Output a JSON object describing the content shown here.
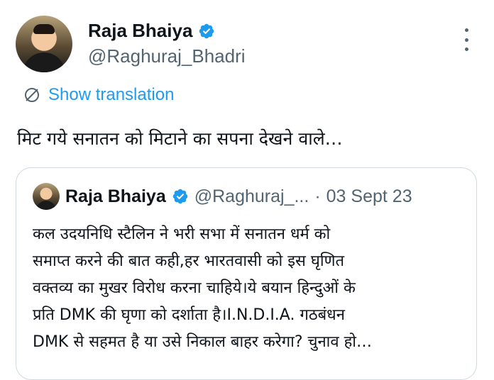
{
  "author": {
    "display_name": "Raja Bhaiya",
    "handle": "@Raghuraj_Bhadri",
    "verified_icon": "verified-badge-icon"
  },
  "translate": {
    "label": "Show translation",
    "icon": "globe-icon"
  },
  "tweet": {
    "text": "मिट गये सनातन को मिटाने का सपना देखने वाले…"
  },
  "quoted_tweet": {
    "display_name": "Raja Bhaiya",
    "handle": "@Raghuraj_...",
    "separator": "·",
    "date": "03 Sept 23",
    "lines": [
      "कल उदयनिधि स्टैलिन ने भरी सभा में सनातन धर्म को",
      "समाप्त करने की बात कही,हर भारतवासी को इस घृणित",
      "वक्तव्य का मुखर विरोध करना चाहिये।ये बयान हिन्दुओं के",
      "प्रति DMK की घृणा को दर्शाता है।I.N.D.I.A. गठबंधन",
      "DMK से सहमत है या उसे निकाल बाहर करेगा? चुनाव हो…"
    ]
  },
  "colors": {
    "link_blue": "#1d9bf0",
    "secondary_text": "#536471",
    "border": "#cfd9de"
  }
}
